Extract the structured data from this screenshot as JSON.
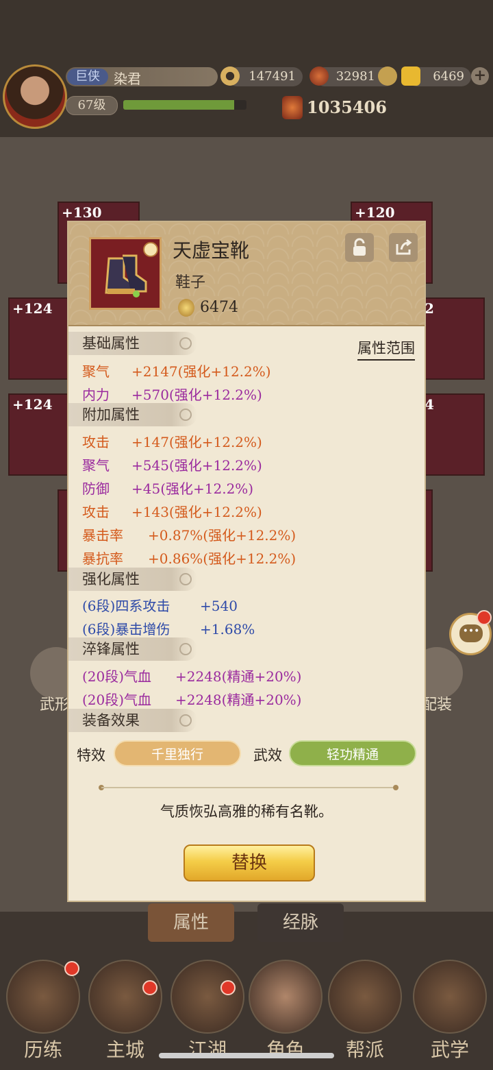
{
  "header": {
    "title_badge": "巨侠",
    "player_name": "染君",
    "level": "67级",
    "xp_progress": 0.9,
    "copper": "147491",
    "silver": "32981",
    "gold": "6469",
    "combat_power": "1035406"
  },
  "behind": {
    "slots": [
      "+130",
      "+120",
      "+124",
      "+124"
    ],
    "slot_right_partial": [
      "2",
      "4"
    ],
    "tabs": [
      "属性",
      "经脉"
    ],
    "side_left": "武形",
    "side_right": "配装"
  },
  "nav": [
    "历练",
    "主城",
    "江湖",
    "角色",
    "帮派",
    "武学"
  ],
  "item": {
    "name": "天虚宝靴",
    "type": "鞋子",
    "power": "6474",
    "range_link": "属性范围",
    "sections": {
      "base": "基础属性",
      "extra": "附加属性",
      "enhance": "强化属性",
      "temper": "淬锋属性",
      "effect": "装备效果"
    },
    "base_stats": [
      {
        "name": "聚气",
        "value": "+2147(强化+12.2%)"
      },
      {
        "name": "内力",
        "value": "+570(强化+12.2%)"
      }
    ],
    "extra_stats": [
      {
        "name": "攻击",
        "value": "+147(强化+12.2%)"
      },
      {
        "name": "聚气",
        "value": "+545(强化+12.2%)"
      },
      {
        "name": "防御",
        "value": "+45(强化+12.2%)"
      },
      {
        "name": "攻击",
        "value": "+143(强化+12.2%)"
      },
      {
        "name": "暴击率",
        "value": "+0.87%(强化+12.2%)"
      },
      {
        "name": "暴抗率",
        "value": "+0.86%(强化+12.2%)"
      }
    ],
    "enhance_stats": [
      {
        "name": "(6段)四系攻击",
        "value": "+540"
      },
      {
        "name": "(6段)暴击增伤",
        "value": "+1.68%"
      }
    ],
    "temper_stats": [
      {
        "name": "(20段)气血",
        "value": "+2248(精通+20%)"
      },
      {
        "name": "(20段)气血",
        "value": "+2248(精通+20%)"
      }
    ],
    "special_label": "特效",
    "special_value": "千里独行",
    "martial_label": "武效",
    "martial_value": "轻功精通",
    "description": "气质恢弘高雅的稀有名靴。",
    "replace_label": "替换"
  },
  "colors": {
    "orange_stat": "#d45a1c",
    "purple_stat": "#9a2a9e",
    "blue_stat": "#2e4aa8",
    "special_pill": "#e3b672",
    "martial_pill": "#8fb04a",
    "replace_button": "#f4cd48"
  },
  "icons": [
    "copper-coin-icon",
    "silver-ingot-icon",
    "gold-ingot-icon",
    "lock-icon",
    "share-icon",
    "chat-icon",
    "combat-power-icon"
  ]
}
